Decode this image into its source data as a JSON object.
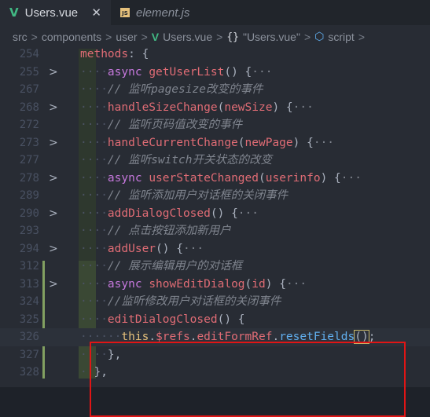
{
  "tabs": [
    {
      "label": "Users.vue",
      "icon": "V",
      "active": true,
      "close": "✕"
    },
    {
      "label": "element.js",
      "icon": "JS",
      "active": false
    }
  ],
  "breadcrumb": {
    "items": [
      "src",
      "components",
      "user",
      "Users.vue",
      "\"Users.vue\"",
      "script"
    ],
    "braces": "{}",
    "separator": ">"
  },
  "colors": {
    "keyword": "#c678dd",
    "method": "#e06c75",
    "comment": "#7f848e",
    "annotation_box": "#e01515"
  },
  "code_lines": [
    {
      "ln": "254",
      "fold": "",
      "html": "<span class='fn'>methods</span>: {"
    },
    {
      "ln": "255",
      "fold": ">",
      "html": "<span class='dots'>····</span><span class='kw'>async</span> <span class='fn'>getUserList</span>() {<span class='fd'>···</span>"
    },
    {
      "ln": "267",
      "fold": "",
      "html": "<span class='dots'>····</span><span class='cm'>// 监听pagesize改变的事件</span>"
    },
    {
      "ln": "268",
      "fold": ">",
      "html": "<span class='dots'>····</span><span class='fn'>handleSizeChange</span>(<span class='par'>newSize</span>) {<span class='fd'>···</span>"
    },
    {
      "ln": "272",
      "fold": "",
      "html": "<span class='dots'>····</span><span class='cm'>// 监听页码值改变的事件</span>"
    },
    {
      "ln": "273",
      "fold": ">",
      "html": "<span class='dots'>····</span><span class='fn'>handleCurrentChange</span>(<span class='par'>newPage</span>) {<span class='fd'>···</span>"
    },
    {
      "ln": "277",
      "fold": "",
      "html": "<span class='dots'>····</span><span class='cm'>// 监听switch开关状态的改变</span>"
    },
    {
      "ln": "278",
      "fold": ">",
      "html": "<span class='dots'>····</span><span class='kw'>async</span> <span class='fn'>userStateChanged</span>(<span class='par'>userinfo</span>) {<span class='fd'>···</span>"
    },
    {
      "ln": "289",
      "fold": "",
      "html": "<span class='dots'>····</span><span class='cm'>// 监听添加用户对话框的关闭事件</span>"
    },
    {
      "ln": "290",
      "fold": ">",
      "html": "<span class='dots'>····</span><span class='fn'>addDialogClosed</span>() {<span class='fd'>···</span>"
    },
    {
      "ln": "293",
      "fold": "",
      "html": "<span class='dots'>····</span><span class='cm'>// 点击按钮添加新用户</span>"
    },
    {
      "ln": "294",
      "fold": ">",
      "html": "<span class='dots'>····</span><span class='fn'>addUser</span>() {<span class='fd'>···</span>"
    },
    {
      "ln": "312",
      "fold": "",
      "html": "<span class='dots'>····</span><span class='cm'>// 展示编辑用户的对话框</span>"
    },
    {
      "ln": "313",
      "fold": ">",
      "html": "<span class='dots'>····</span><span class='kw'>async</span> <span class='fn'>showEditDialog</span>(<span class='par'>id</span>) {<span class='fd'>···</span>"
    },
    {
      "ln": "324",
      "fold": "",
      "html": "<span class='dots'>····</span><span class='cm'>//监听修改用户对话框的关闭事件</span>"
    },
    {
      "ln": "325",
      "fold": "",
      "html": "<span class='dots'>····</span><span class='fn'>editDialogClosed</span>() {"
    },
    {
      "ln": "326",
      "fold": "",
      "html": "<span class='dots'>······</span><span class='pr'>this</span>.<span class='fn'>$refs</span>.<span class='fn'>editFormRef</span>.<span class='fnb'>resetFields</span><span class='bracket-box'>()</span>;",
      "current": true
    },
    {
      "ln": "327",
      "fold": "",
      "html": "<span class='dots'>····</span>},"
    },
    {
      "ln": "328",
      "fold": "",
      "html": "<span class='dots'>··</span>},"
    }
  ]
}
